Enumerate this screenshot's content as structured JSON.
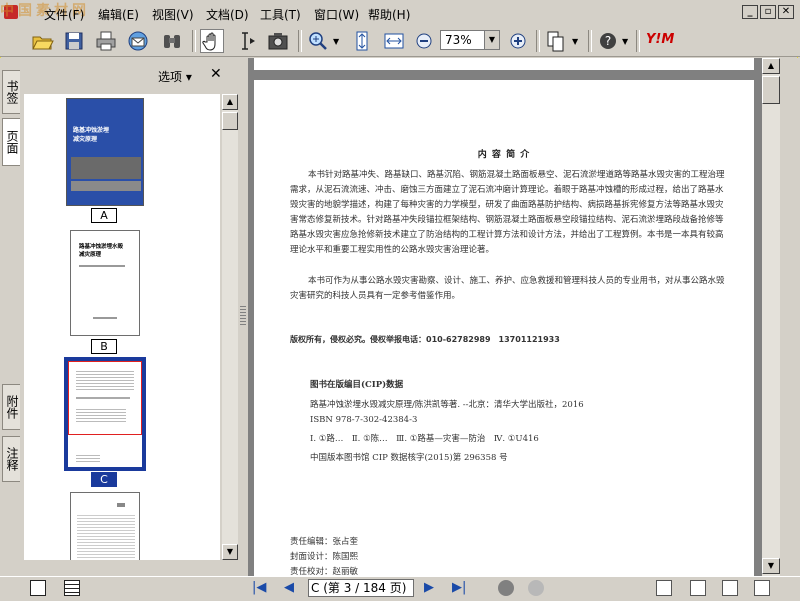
{
  "watermark": "中国素材网",
  "menu": [
    "文件(F)",
    "编辑(E)",
    "视图(V)",
    "文档(D)",
    "工具(T)",
    "窗口(W)",
    "帮助(H)"
  ],
  "toolbar": {
    "zoom_value": "73%",
    "brand": "Y!M"
  },
  "tabs": [
    "书签",
    "页面",
    "附件",
    "注释"
  ],
  "panel": {
    "options_label": "选项",
    "thumbnails": [
      {
        "label": "A",
        "cover_title": "路基冲蚀淤埋\n减灾原理"
      },
      {
        "label": "B",
        "title": "路基冲蚀淤埋水毁\n减灾原理"
      },
      {
        "label": "C"
      },
      {
        "label": ""
      }
    ]
  },
  "document": {
    "heading": "内 容 简 介",
    "paragraph1": "本书针对路基冲失、路基缺口、路基沉陷、钢筋混凝土路面板悬空、泥石流淤埋道路等路基水毁灾害的工程治理需求，从泥石流流速、冲击、磨蚀三方面建立了泥石流冲磨计算理论。着眼于路基冲蚀槽的形成过程，给出了路基水毁灾害的地貌学描述，构建了每种灾害的力学模型，研发了曲面路基防护结构、病损路基拆宪修复方法等路基水毁灾害常态修复新技术。针对路基冲失段锚拉框架结构、钢筋混凝土路面板悬空段锚拉结构、泥石流淤埋路段战备抢修等路基水毁灾害应急抢修新技术建立了防治结构的工程计算方法和设计方法，并给出了工程算例。本书是一本具有较高理论水平和重要工程实用性的公路水毁灾害治理论著。",
    "paragraph2": "本书可作为从事公路水毁灾害勘察、设计、施工、养护、应急救援和管理科技人员的专业用书，对从事公路水毁灾害研究的科技人员具有一定参考借鉴作用。",
    "copyright": "版权所有，侵权必究。侵权举报电话：010-62782989　13701121933",
    "cip_title": "图书在版编目(CIP)数据",
    "cip_line1": "路基冲蚀淤埋水毁减灾原理/陈洪凯等著. --北京：清华大学出版社，2016",
    "cip_line2": "ISBN 978-7-302-42384-3",
    "cip_line3": "Ⅰ. ①路…　Ⅱ. ①陈…　Ⅲ. ①路基—灾害—防治　Ⅳ. ①U416",
    "cip_line4": "中国版本图书馆 CIP 数据核字(2015)第 296358 号",
    "editor": "责任编辑：张占奎",
    "cover_design": "封面设计：陈国熙",
    "proofreader": "责任校对：赵丽敏"
  },
  "status": {
    "page_indicator": "C (第 3 / 184 页)"
  },
  "colors": {
    "selection": "#1a3a9c",
    "watermark": "#d28c28",
    "cover": "#2a4fa8"
  }
}
